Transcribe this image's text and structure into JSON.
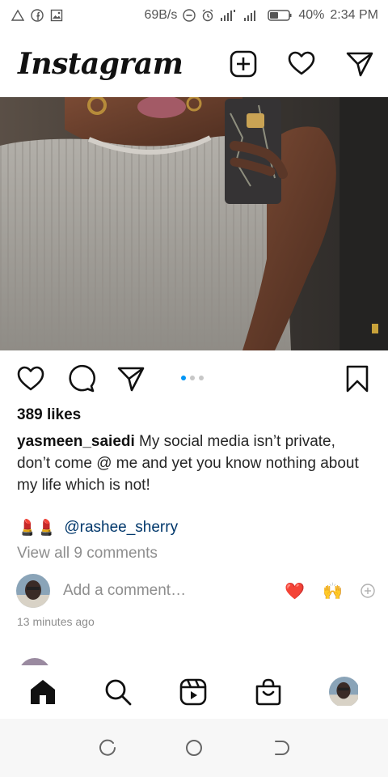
{
  "status_bar": {
    "net_speed": "69B/s",
    "battery": "40%",
    "time": "2:34 PM",
    "left_icons": [
      "warning-triangle-icon",
      "facebook-icon",
      "gallery-icon"
    ],
    "right_icons": [
      "dnd-icon",
      "alarm-icon",
      "signal-icon",
      "signal-icon",
      "battery-icon"
    ]
  },
  "header": {
    "logo": "Instagram",
    "icons": [
      "new-post-icon",
      "heart-icon",
      "direct-message-icon"
    ]
  },
  "post": {
    "carousel": {
      "count": 3,
      "active_index": 0
    },
    "likes": "389 likes",
    "author": "yasmeen_saiedi",
    "caption": " My social media isn’t private, don’t come @ me and yet you know nothing about my life which is not!",
    "tag_emoji": "💄💄",
    "mention": "@rashee_sherry",
    "view_comments": "View all 9 comments",
    "comment_placeholder": "Add a comment…",
    "quick_reactions": [
      "❤️",
      "🙌"
    ],
    "timestamp": "13 minutes ago"
  },
  "bottom_nav": {
    "items": [
      "home-icon",
      "search-icon",
      "reels-icon",
      "shop-icon",
      "profile-avatar"
    ]
  },
  "system_nav": [
    "recents-icon",
    "home-circle-icon",
    "back-icon"
  ],
  "colors": {
    "accent_blue": "#0095f6",
    "mention": "#00376b",
    "muted": "#8e8e8e",
    "heart_red": "#ed4956"
  }
}
